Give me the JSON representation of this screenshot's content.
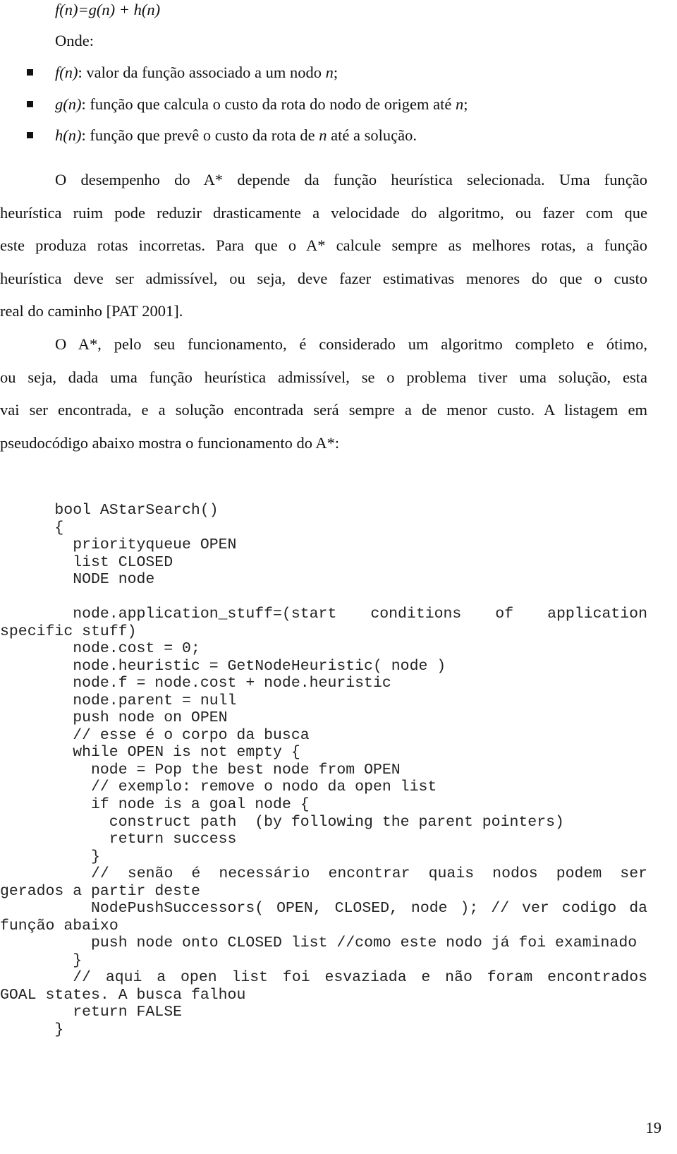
{
  "formula": "f(n)=g(n) + h(n)",
  "onde": "Onde:",
  "bullets": [
    {
      "term": "f(n)",
      "rest": ": valor da função associado a um nodo ",
      "n": "n",
      "end": ";"
    },
    {
      "term": "g(n)",
      "rest": ": função que calcula o custo da rota do nodo de origem até ",
      "n": "n",
      "end": ";"
    },
    {
      "term": "h(n)",
      "rest": ": função que prevê o custo da rota de ",
      "n": "n",
      "end": " até a solução."
    }
  ],
  "paragraphs": [
    [
      "O desempenho do A* depende da função heurística selecionada. Uma função",
      "heurística ruim pode reduzir drasticamente a velocidade do algoritmo, ou fazer com que",
      "este produza rotas incorretas. Para que o A* calcule sempre as melhores rotas, a função",
      "heurística deve ser admissível, ou seja, deve fazer estimativas menores do que o custo",
      "real do caminho [PAT 2001]."
    ],
    [
      "O A*, pelo seu funcionamento, é considerado um algoritmo completo e ótimo,",
      "ou seja, dada uma função heurística admissível, se o problema tiver uma solução, esta",
      "vai ser encontrada, e a solução encontrada será sempre a de menor custo. A listagem em",
      "pseudocódigo abaixo mostra o funcionamento do A*:"
    ]
  ],
  "code": [
    {
      "text": "      bool AStarSearch()"
    },
    {
      "text": "      {"
    },
    {
      "text": "        priorityqueue OPEN"
    },
    {
      "text": "        list CLOSED"
    },
    {
      "text": "        NODE node"
    },
    {
      "text": ""
    },
    {
      "text": "        node.application_stuff=(start conditions of application",
      "justify": true
    },
    {
      "text": "specific stuff)"
    },
    {
      "text": "        node.cost = 0;"
    },
    {
      "text": "        node.heuristic = GetNodeHeuristic( node )"
    },
    {
      "text": "        node.f = node.cost + node.heuristic"
    },
    {
      "text": "        node.parent = null"
    },
    {
      "text": "        push node on OPEN"
    },
    {
      "text": "        // esse é o corpo da busca"
    },
    {
      "text": "        while OPEN is not empty {"
    },
    {
      "text": "          node = Pop the best node from OPEN"
    },
    {
      "text": "          // exemplo: remove o nodo da open list"
    },
    {
      "text": "          if node is a goal node {"
    },
    {
      "text": "            construct path  (by following the parent pointers)"
    },
    {
      "text": "            return success"
    },
    {
      "text": "          }"
    },
    {
      "text": "          // senão é necessário encontrar quais nodos podem ser",
      "justify": true
    },
    {
      "text": "gerados a partir deste"
    },
    {
      "text": "          NodePushSuccessors( OPEN, CLOSED, node ); // ver codigo da",
      "justify": true
    },
    {
      "text": "função abaixo"
    },
    {
      "text": "          push node onto CLOSED list //como este nodo já foi examinado"
    },
    {
      "text": "        }"
    },
    {
      "text": "        // aqui a open list foi esvaziada e não foram encontrados",
      "justify": true
    },
    {
      "text": "GOAL states. A busca falhou"
    },
    {
      "text": "        return FALSE"
    },
    {
      "text": "      }"
    }
  ],
  "page_number": "19"
}
